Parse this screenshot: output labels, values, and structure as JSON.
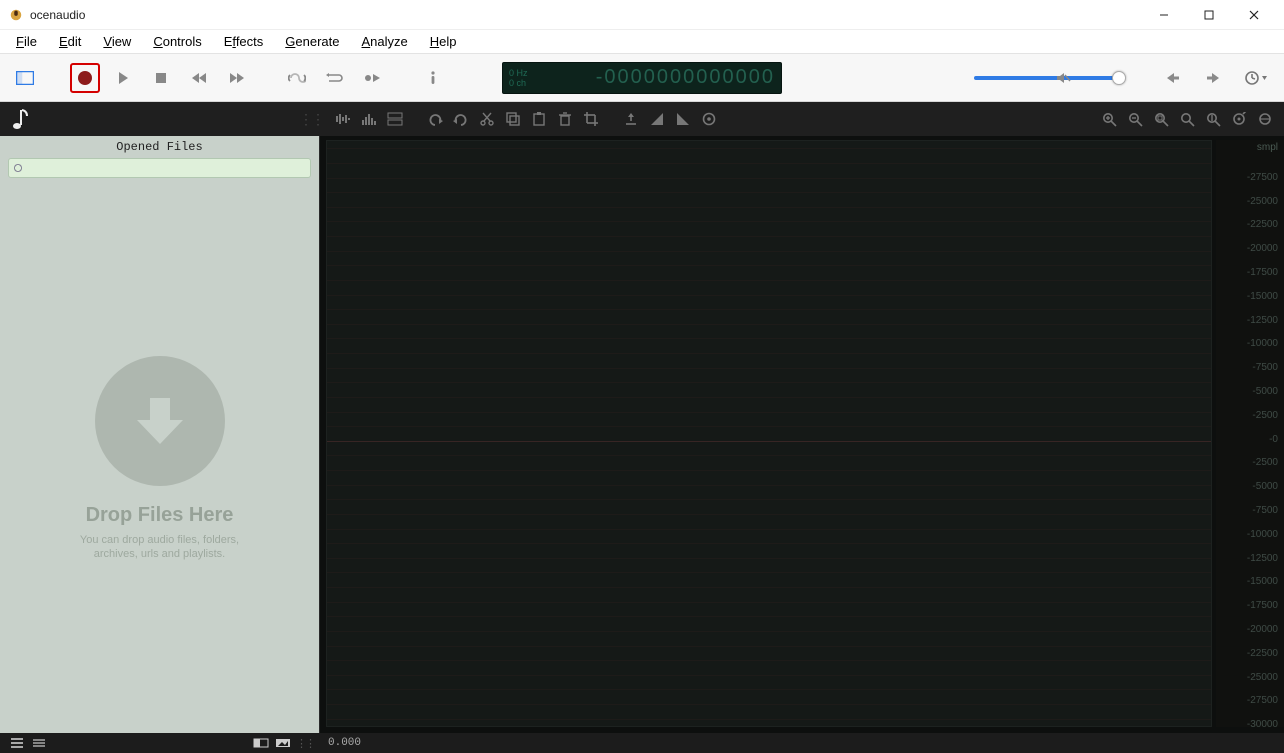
{
  "app": {
    "title": "ocenaudio"
  },
  "menu": {
    "items": [
      {
        "label": "File",
        "hotkey_index": 0
      },
      {
        "label": "Edit",
        "hotkey_index": 0
      },
      {
        "label": "View",
        "hotkey_index": 0
      },
      {
        "label": "Controls",
        "hotkey_index": 0
      },
      {
        "label": "Effects",
        "hotkey_index": 0
      },
      {
        "label": "Generate",
        "hotkey_index": 0
      },
      {
        "label": "Analyze",
        "hotkey_index": 0
      },
      {
        "label": "Help",
        "hotkey_index": 0
      }
    ]
  },
  "toolbar": {
    "lcd": {
      "hz": "0 Hz",
      "ch": "0 ch",
      "time": "-0000000000000"
    },
    "volume_percent": 100
  },
  "sidebar": {
    "header": "Opened Files",
    "search_placeholder": "",
    "drop_title": "Drop Files Here",
    "drop_subtitle": "You can drop audio files, folders, archives, urls and playlists."
  },
  "ruler": {
    "unit": "smpl",
    "ticks": [
      "-27500",
      "-25000",
      "-22500",
      "-20000",
      "-17500",
      "-15000",
      "-12500",
      "-10000",
      "-7500",
      "-5000",
      "-2500",
      "-0",
      "-2500",
      "-5000",
      "-7500",
      "-10000",
      "-12500",
      "-15000",
      "-17500",
      "-20000",
      "-22500",
      "-25000",
      "-27500",
      "-30000"
    ]
  },
  "status": {
    "time": "0.000"
  }
}
